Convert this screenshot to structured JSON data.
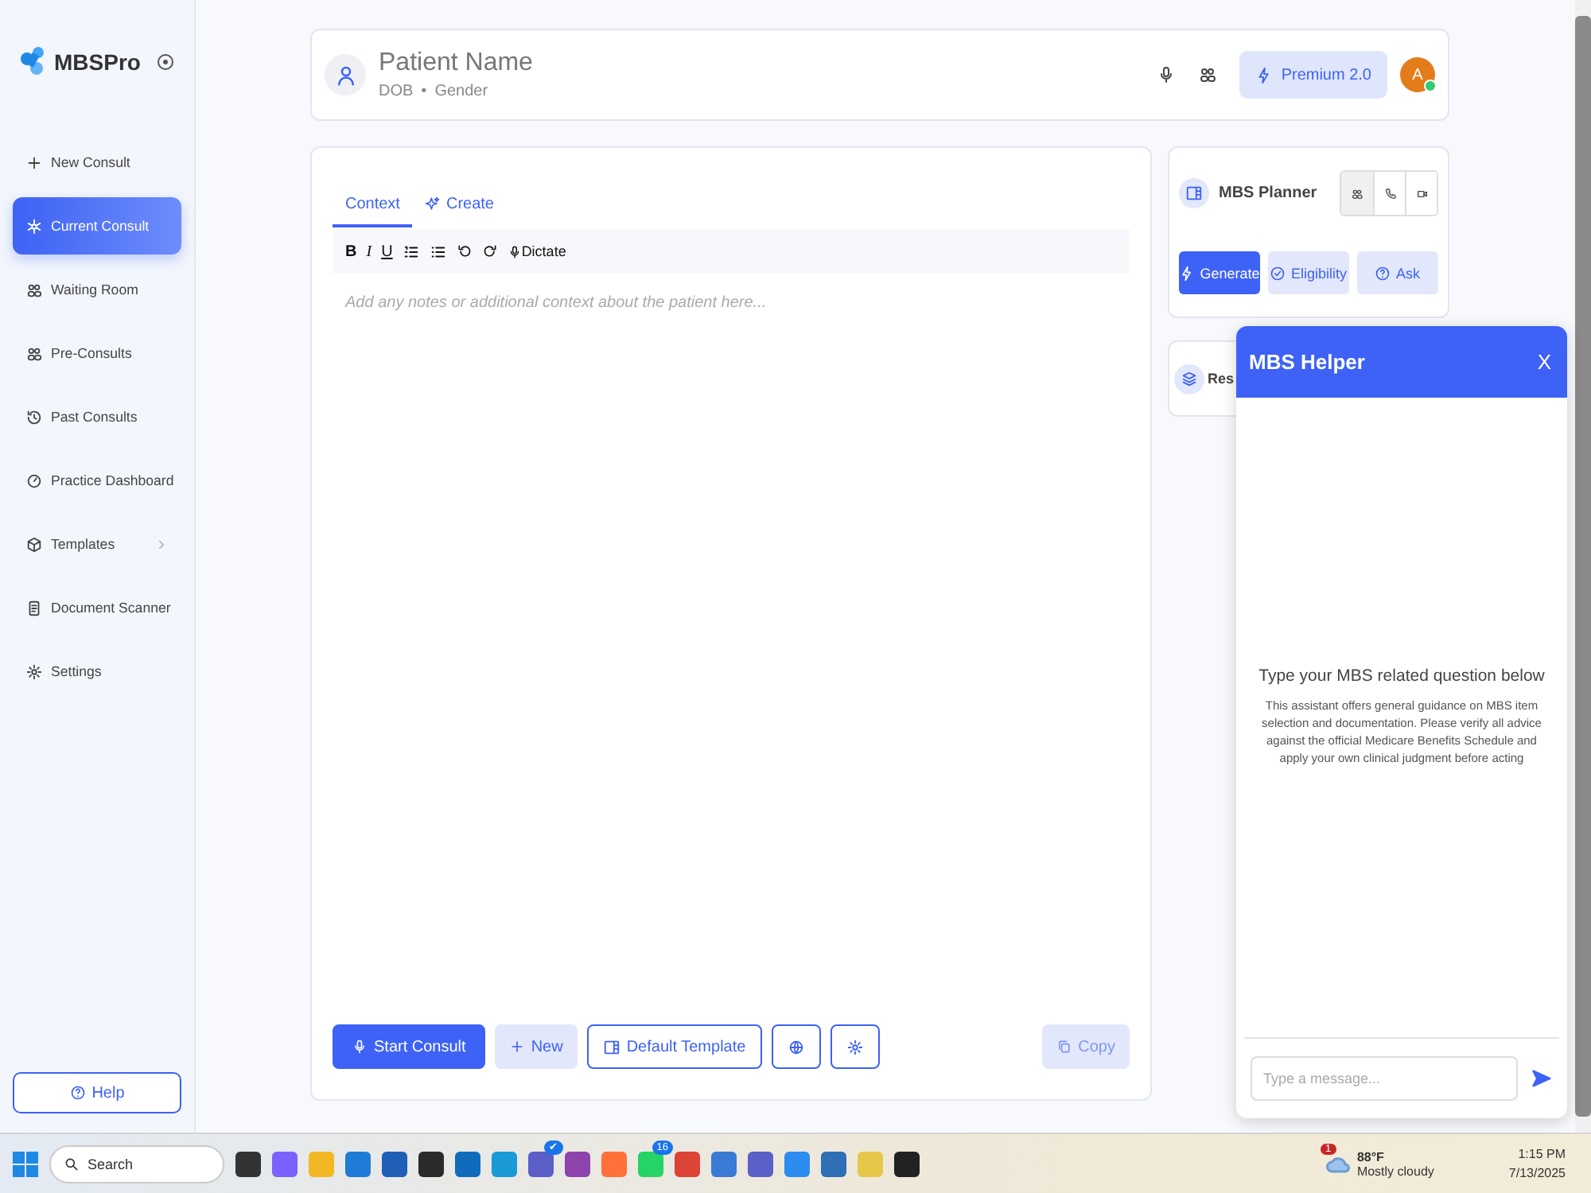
{
  "sidebar": {
    "brand": "MBSPro",
    "items": [
      {
        "label": "New Consult",
        "selected": false
      },
      {
        "label": "Current Consult",
        "selected": true
      },
      {
        "label": "Waiting Room",
        "selected": false
      },
      {
        "label": "Pre-Consults",
        "selected": false
      },
      {
        "label": "Past Consults",
        "selected": false
      },
      {
        "label": "Practice Dashboard",
        "selected": false
      },
      {
        "label": "Templates",
        "selected": false,
        "submenu": true
      },
      {
        "label": "Document Scanner",
        "selected": false
      },
      {
        "label": "Settings",
        "selected": false
      }
    ],
    "help": "Help"
  },
  "patient": {
    "name": "Patient Name",
    "dob": "DOB",
    "separator": "•",
    "gender": "Gender",
    "premium": "Premium 2.0",
    "avatar": "A",
    "online": true
  },
  "editor": {
    "tabs": [
      {
        "label": "Context",
        "selected": true
      },
      {
        "label": "Create",
        "selected": false
      }
    ],
    "toolbar": [
      {
        "kind": "bold",
        "label": "B"
      },
      {
        "kind": "italic",
        "label": "I"
      },
      {
        "kind": "underline",
        "label": "U"
      },
      {
        "kind": "ordered"
      },
      {
        "kind": "bullets"
      },
      {
        "kind": "undo"
      },
      {
        "kind": "redo"
      },
      {
        "kind": "dictate",
        "label": "Dictate"
      }
    ],
    "placeholder": "Add any notes or additional context about the patient here...",
    "buttons": [
      {
        "kind": "primary",
        "label": "Start Consult"
      },
      {
        "kind": "soft",
        "label": "New"
      },
      {
        "kind": "outline",
        "label": "Default Template"
      },
      {
        "kind": "outline"
      },
      {
        "kind": "outline"
      },
      {
        "kind": "copy",
        "label": "Copy"
      }
    ]
  },
  "planner": {
    "title": "MBS Planner",
    "modes": [
      {
        "selected": true
      },
      {
        "selected": false
      },
      {
        "selected": false
      }
    ],
    "actions": [
      {
        "label": "Generate",
        "selected": true
      },
      {
        "label": "Eligibility",
        "selected": false
      },
      {
        "label": "Ask",
        "selected": false
      }
    ]
  },
  "resources": {
    "title": "Res"
  },
  "helper": {
    "title": "MBS Helper",
    "close": "X",
    "heading": "Type your MBS related question below",
    "body": "This assistant offers general guidance on MBS item selection and documentation. Please verify all advice against the official Medicare Benefits Schedule and apply your own clinical judgment before acting",
    "placeholder": "Type a message..."
  },
  "taskbar": {
    "search": "Search",
    "apps": [
      {
        "color": "#333333"
      },
      {
        "color": "#7b61ff"
      },
      {
        "color": "#f2b824"
      },
      {
        "color": "#1e7bd6"
      },
      {
        "color": "#1f5fb8"
      },
      {
        "color": "#2b2b2b"
      },
      {
        "color": "#0f6cbd"
      },
      {
        "color": "#1a9bd7"
      },
      {
        "color": "#5b5fc7",
        "badge": "✔"
      },
      {
        "color": "#8e44ad"
      },
      {
        "color": "#ff7139"
      },
      {
        "color": "#25d366",
        "badge": "16"
      },
      {
        "color": "#db4437"
      },
      {
        "color": "#3a7bd5"
      },
      {
        "color": "#5b5fc7"
      },
      {
        "color": "#2d8cf0"
      },
      {
        "color": "#2e6fb5"
      },
      {
        "color": "#e5c84a"
      },
      {
        "color": "#222222"
      }
    ],
    "weather": {
      "alerts": "1",
      "temp": "88°F",
      "condition": "Mostly cloudy"
    },
    "time": "1:15 PM",
    "date": "7/13/2025"
  }
}
